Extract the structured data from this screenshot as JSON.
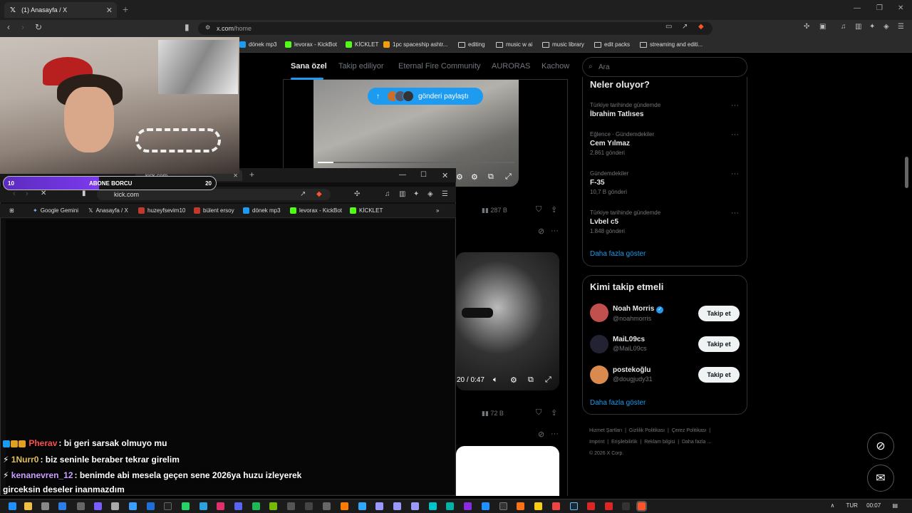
{
  "browser": {
    "tab_title": "(1) Anasayfa / X",
    "url_prefix": "x.com",
    "url_path": "/home",
    "bookmarks": [
      {
        "label": "dönek mp3",
        "color": "#1d9bf0"
      },
      {
        "label": "levorax - KickBot",
        "color": "#53fc18"
      },
      {
        "label": "KİCKLET",
        "color": "#53fc18"
      },
      {
        "label": "1pc spaceship ashtr...",
        "color": "#f59e0b"
      },
      {
        "label": "editing",
        "folder": true
      },
      {
        "label": "music w ai",
        "folder": true
      },
      {
        "label": "music library",
        "folder": true
      },
      {
        "label": "edit packs",
        "folder": true
      },
      {
        "label": "streaming and editi...",
        "folder": true
      }
    ]
  },
  "x": {
    "tabs": [
      "Sana özel",
      "Takip ediliyor",
      "Eternal Fire Community",
      "AURORAS",
      "Kachow"
    ],
    "share_pill": "gönderi paylaştı",
    "post1_views": "287 B",
    "post2_time": "0:20 / 0:47",
    "post2_time_visible": "20 / 0:47",
    "post2_views": "72 B",
    "search_placeholder": "Ara",
    "trends_title": "Neler oluyor?",
    "trends": [
      {
        "category": "Türkiye tarihinde gündemde",
        "name": "İbrahim Tatlıses",
        "count": ""
      },
      {
        "category": "Eğlence · Gündemdekiler",
        "name": "Cem Yılmaz",
        "count": "2.861 gönderi"
      },
      {
        "category": "Gündemdekiler",
        "name": "F-35",
        "count": "10,7 B gönderi"
      },
      {
        "category": "Türkiye tarihinde gündemde",
        "name": "Lvbel c5",
        "count": "1.848 gönderi"
      }
    ],
    "show_more": "Daha fazla göster",
    "follow_title": "Kimi takip etmeli",
    "follow": [
      {
        "name": "Noah Morris",
        "handle": "@noahmorris",
        "verified": true,
        "color": "#c0504d"
      },
      {
        "name": "MaiL09cs",
        "handle": "@MaiL09cs",
        "verified": false,
        "color": "#333344"
      },
      {
        "name": "postekoğlu",
        "handle": "@dougjudy31",
        "verified": false,
        "color": "#d98b4f"
      }
    ],
    "follow_label": "Takip et",
    "footer": {
      "row1": [
        "Hizmet Şartları",
        "Gizlilik Politikası",
        "Çerez Politikası"
      ],
      "row2": [
        "Imprint",
        "Erişilebilirlik",
        "Reklam bilgisi",
        "Daha fazla ..."
      ],
      "copyright": "© 2026 X Corp."
    }
  },
  "stream": {
    "sub_bar": {
      "left": "10",
      "center": "ABONE BORCU",
      "right": "20",
      "progress_fraction": 0.45
    },
    "chat": [
      {
        "user": "Pherav",
        "color": "#ff4d4d",
        "message": ": bi geri sarsak olmuyo mu"
      },
      {
        "user": "1Nurr0",
        "color": "#e0c060",
        "message": ": biz seninle beraber tekrar girelim"
      },
      {
        "user": "kenanevren_12",
        "color": "#c9a0ff",
        "message": ": benimde abi mesela geçen sene 2026ya huzu izleyerek"
      },
      {
        "user": "",
        "color": "#fff",
        "message": "girceksin deseler inanmazdım"
      }
    ]
  },
  "inner_browser": {
    "tab_title": "kick.com",
    "url": "kick.com",
    "bookmarks": [
      "Google Gemini",
      "Anasayfa / X",
      "huzeyfsevim10",
      "bülent ersoy",
      "dönek mp3",
      "levorax - KickBot",
      "KİCKLET"
    ]
  },
  "taskbar": {
    "lang": "TUR",
    "time": "00:07"
  }
}
